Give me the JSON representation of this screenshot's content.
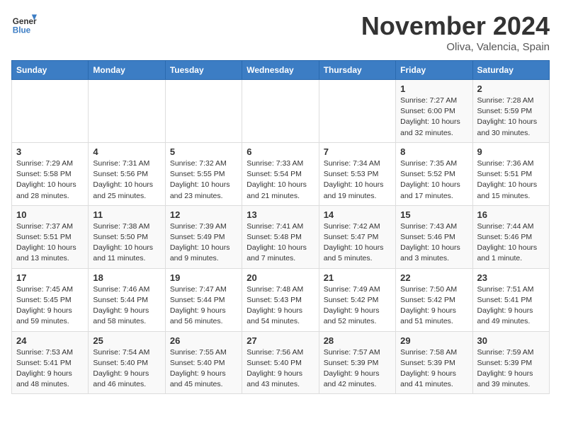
{
  "logo": {
    "line1": "General",
    "line2": "Blue"
  },
  "title": "November 2024",
  "location": "Oliva, Valencia, Spain",
  "weekdays": [
    "Sunday",
    "Monday",
    "Tuesday",
    "Wednesday",
    "Thursday",
    "Friday",
    "Saturday"
  ],
  "weeks": [
    [
      {
        "day": "",
        "data": ""
      },
      {
        "day": "",
        "data": ""
      },
      {
        "day": "",
        "data": ""
      },
      {
        "day": "",
        "data": ""
      },
      {
        "day": "",
        "data": ""
      },
      {
        "day": "1",
        "data": "Sunrise: 7:27 AM\nSunset: 6:00 PM\nDaylight: 10 hours and 32 minutes."
      },
      {
        "day": "2",
        "data": "Sunrise: 7:28 AM\nSunset: 5:59 PM\nDaylight: 10 hours and 30 minutes."
      }
    ],
    [
      {
        "day": "3",
        "data": "Sunrise: 7:29 AM\nSunset: 5:58 PM\nDaylight: 10 hours and 28 minutes."
      },
      {
        "day": "4",
        "data": "Sunrise: 7:31 AM\nSunset: 5:56 PM\nDaylight: 10 hours and 25 minutes."
      },
      {
        "day": "5",
        "data": "Sunrise: 7:32 AM\nSunset: 5:55 PM\nDaylight: 10 hours and 23 minutes."
      },
      {
        "day": "6",
        "data": "Sunrise: 7:33 AM\nSunset: 5:54 PM\nDaylight: 10 hours and 21 minutes."
      },
      {
        "day": "7",
        "data": "Sunrise: 7:34 AM\nSunset: 5:53 PM\nDaylight: 10 hours and 19 minutes."
      },
      {
        "day": "8",
        "data": "Sunrise: 7:35 AM\nSunset: 5:52 PM\nDaylight: 10 hours and 17 minutes."
      },
      {
        "day": "9",
        "data": "Sunrise: 7:36 AM\nSunset: 5:51 PM\nDaylight: 10 hours and 15 minutes."
      }
    ],
    [
      {
        "day": "10",
        "data": "Sunrise: 7:37 AM\nSunset: 5:51 PM\nDaylight: 10 hours and 13 minutes."
      },
      {
        "day": "11",
        "data": "Sunrise: 7:38 AM\nSunset: 5:50 PM\nDaylight: 10 hours and 11 minutes."
      },
      {
        "day": "12",
        "data": "Sunrise: 7:39 AM\nSunset: 5:49 PM\nDaylight: 10 hours and 9 minutes."
      },
      {
        "day": "13",
        "data": "Sunrise: 7:41 AM\nSunset: 5:48 PM\nDaylight: 10 hours and 7 minutes."
      },
      {
        "day": "14",
        "data": "Sunrise: 7:42 AM\nSunset: 5:47 PM\nDaylight: 10 hours and 5 minutes."
      },
      {
        "day": "15",
        "data": "Sunrise: 7:43 AM\nSunset: 5:46 PM\nDaylight: 10 hours and 3 minutes."
      },
      {
        "day": "16",
        "data": "Sunrise: 7:44 AM\nSunset: 5:46 PM\nDaylight: 10 hours and 1 minute."
      }
    ],
    [
      {
        "day": "17",
        "data": "Sunrise: 7:45 AM\nSunset: 5:45 PM\nDaylight: 9 hours and 59 minutes."
      },
      {
        "day": "18",
        "data": "Sunrise: 7:46 AM\nSunset: 5:44 PM\nDaylight: 9 hours and 58 minutes."
      },
      {
        "day": "19",
        "data": "Sunrise: 7:47 AM\nSunset: 5:44 PM\nDaylight: 9 hours and 56 minutes."
      },
      {
        "day": "20",
        "data": "Sunrise: 7:48 AM\nSunset: 5:43 PM\nDaylight: 9 hours and 54 minutes."
      },
      {
        "day": "21",
        "data": "Sunrise: 7:49 AM\nSunset: 5:42 PM\nDaylight: 9 hours and 52 minutes."
      },
      {
        "day": "22",
        "data": "Sunrise: 7:50 AM\nSunset: 5:42 PM\nDaylight: 9 hours and 51 minutes."
      },
      {
        "day": "23",
        "data": "Sunrise: 7:51 AM\nSunset: 5:41 PM\nDaylight: 9 hours and 49 minutes."
      }
    ],
    [
      {
        "day": "24",
        "data": "Sunrise: 7:53 AM\nSunset: 5:41 PM\nDaylight: 9 hours and 48 minutes."
      },
      {
        "day": "25",
        "data": "Sunrise: 7:54 AM\nSunset: 5:40 PM\nDaylight: 9 hours and 46 minutes."
      },
      {
        "day": "26",
        "data": "Sunrise: 7:55 AM\nSunset: 5:40 PM\nDaylight: 9 hours and 45 minutes."
      },
      {
        "day": "27",
        "data": "Sunrise: 7:56 AM\nSunset: 5:40 PM\nDaylight: 9 hours and 43 minutes."
      },
      {
        "day": "28",
        "data": "Sunrise: 7:57 AM\nSunset: 5:39 PM\nDaylight: 9 hours and 42 minutes."
      },
      {
        "day": "29",
        "data": "Sunrise: 7:58 AM\nSunset: 5:39 PM\nDaylight: 9 hours and 41 minutes."
      },
      {
        "day": "30",
        "data": "Sunrise: 7:59 AM\nSunset: 5:39 PM\nDaylight: 9 hours and 39 minutes."
      }
    ]
  ]
}
